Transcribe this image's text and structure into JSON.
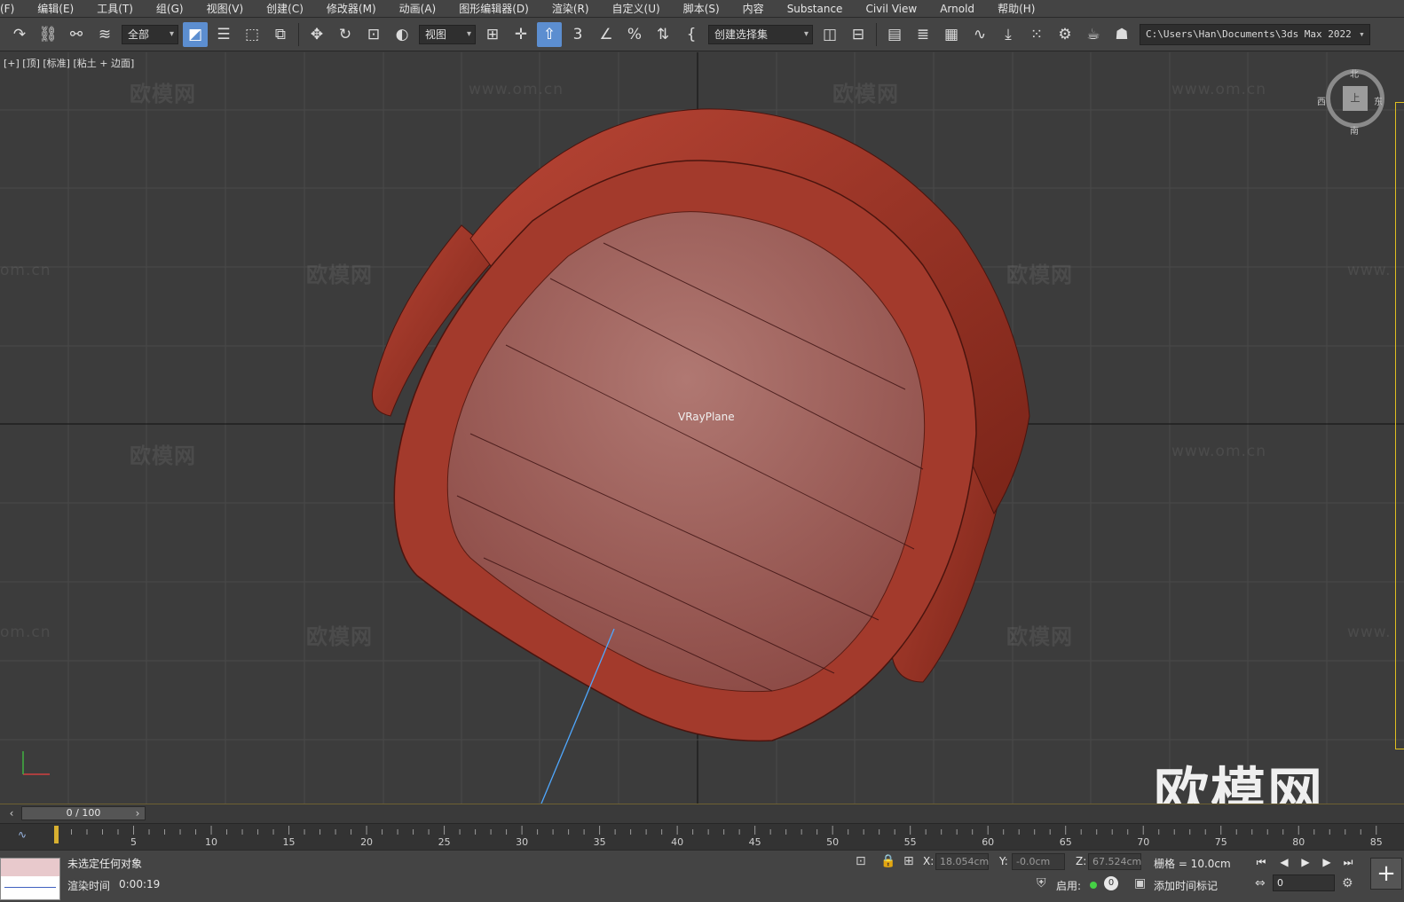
{
  "menubar": {
    "items": [
      "(F)",
      "编辑(E)",
      "工具(T)",
      "组(G)",
      "视图(V)",
      "创建(C)",
      "修改器(M)",
      "动画(A)",
      "图形编辑器(D)",
      "渲染(R)",
      "自定义(U)",
      "脚本(S)",
      "内容",
      "Substance",
      "Civil View",
      "Arnold",
      "帮助(H)"
    ]
  },
  "toolbar": {
    "filter_value": "全部",
    "ref_coord_value": "视图",
    "selection_set_value": "创建选择集",
    "project_path": "C:\\Users\\Han\\Documents\\3ds Max 2022",
    "snap_label": "3"
  },
  "viewport": {
    "label": "[+] [顶] [标准] [粘土 + 边面]",
    "object_label": "VRayPlane",
    "viewcube": {
      "face": "上",
      "north": "北",
      "south": "南",
      "east": "东",
      "west": "西"
    },
    "watermark_cn": "欧模网",
    "watermark_url": "www.om.cn",
    "watermark_url_short": "om.cn",
    "watermark_url_cut": "www.",
    "big_logo": "欧模网"
  },
  "timeline": {
    "frame_display": "0 / 100",
    "ticks": [
      "5",
      "10",
      "15",
      "20",
      "25",
      "30",
      "35",
      "40",
      "45",
      "50",
      "55",
      "60",
      "65",
      "70",
      "75",
      "80",
      "85"
    ]
  },
  "status": {
    "message": "未选定任何对象",
    "render_label": "渲染时间",
    "render_time": "0:00:19",
    "x_label": "X:",
    "x_value": "18.054cm",
    "y_label": "Y:",
    "y_value": "-0.0cm",
    "z_label": "Z:",
    "z_value": "67.524cm",
    "grid_text": "栅格 = 10.0cm",
    "enable_label": "启用:",
    "enable_count": "0",
    "add_time_tag": "添加时间标记",
    "current_frame": "0"
  },
  "colors": {
    "model_dark": "#7a2418",
    "model_mid": "#a83a2c",
    "model_light": "#c9675a",
    "seat_top": "#a76864",
    "viewport_bg": "#3c3c3c",
    "accent_blue": "#5c8ed0"
  }
}
